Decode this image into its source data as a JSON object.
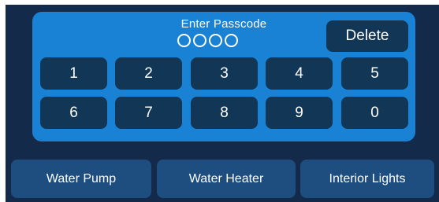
{
  "keypad": {
    "title": "Enter Passcode",
    "dots_filled": 0,
    "dots_total": 4,
    "delete_label": "Delete",
    "keys": [
      "1",
      "2",
      "3",
      "4",
      "5",
      "6",
      "7",
      "8",
      "9",
      "0"
    ]
  },
  "controls": {
    "water_pump": "Water Pump",
    "water_heater": "Water Heater",
    "interior_lights": "Interior Lights"
  },
  "colors": {
    "background": "#142a4b",
    "panel": "#1a82d5",
    "key": "#123656",
    "control_button": "#1d4e7f",
    "text": "#ffffff"
  }
}
